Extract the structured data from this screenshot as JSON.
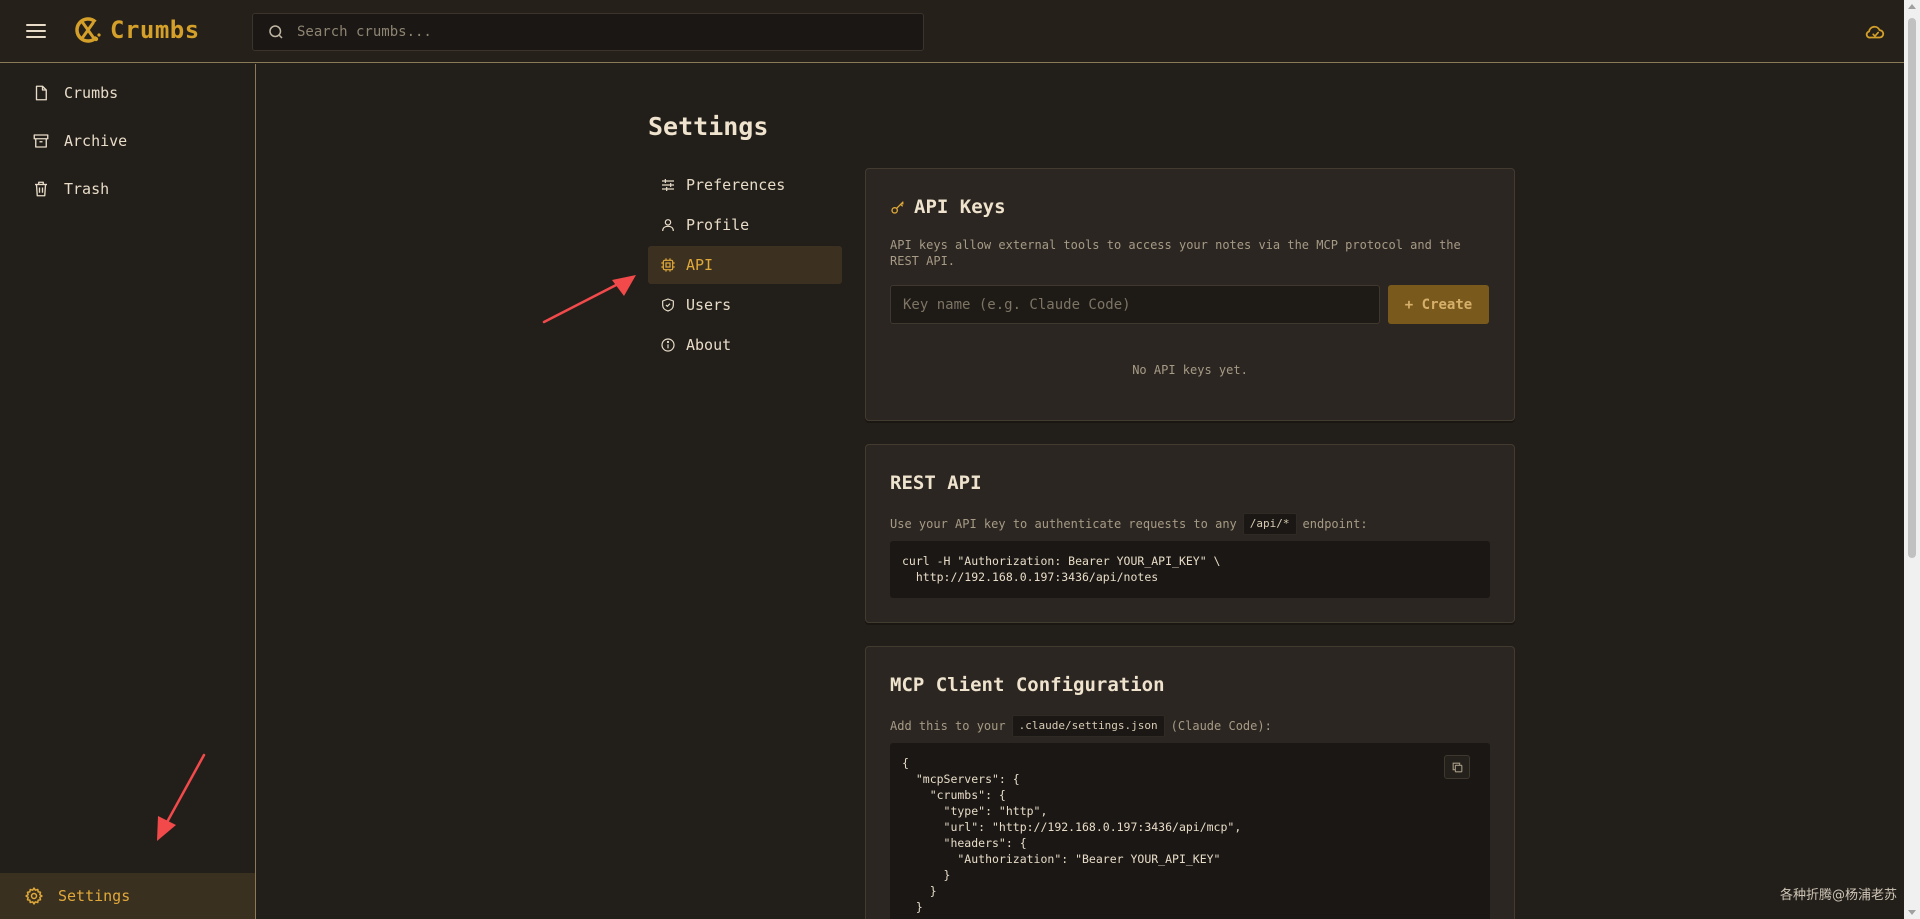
{
  "app": {
    "name": "Crumbs"
  },
  "search": {
    "placeholder": "Search crumbs..."
  },
  "sidebar": {
    "items": [
      {
        "label": "Crumbs",
        "icon": "file-icon"
      },
      {
        "label": "Archive",
        "icon": "archive-icon"
      },
      {
        "label": "Trash",
        "icon": "trash-icon"
      }
    ],
    "settings_label": "Settings"
  },
  "settings": {
    "title": "Settings",
    "nav": [
      {
        "label": "Preferences",
        "icon": "sliders-icon"
      },
      {
        "label": "Profile",
        "icon": "user-icon"
      },
      {
        "label": "API",
        "icon": "chip-icon",
        "active": true
      },
      {
        "label": "Users",
        "icon": "shield-icon"
      },
      {
        "label": "About",
        "icon": "info-icon"
      }
    ]
  },
  "api_keys": {
    "title": "API Keys",
    "description": "API keys allow external tools to access your notes via the MCP protocol and the REST API.",
    "input_placeholder": "Key name (e.g. Claude Code)",
    "create_label": "+ Create",
    "empty_text": "No API keys yet."
  },
  "rest_api": {
    "title": "REST API",
    "desc_before": "Use your API key to authenticate requests to any",
    "desc_code": "/api/*",
    "desc_after": "endpoint:",
    "code": "curl -H \"Authorization: Bearer YOUR_API_KEY\" \\\n  http://192.168.0.197:3436/api/notes"
  },
  "mcp": {
    "title": "MCP Client Configuration",
    "desc_before": "Add this to your",
    "desc_code": ".claude/settings.json",
    "desc_after": "(Claude Code):",
    "code": "{\n  \"mcpServers\": {\n    \"crumbs\": {\n      \"type\": \"http\",\n      \"url\": \"http://192.168.0.197:3436/api/mcp\",\n      \"headers\": {\n        \"Authorization\": \"Bearer YOUR_API_KEY\"\n      }\n    }\n  }"
  },
  "watermark": "各种折腾@杨浦老苏",
  "colors": {
    "accent": "#e1a93a",
    "background": "#221e1a",
    "annotation": "#f24a4a"
  }
}
